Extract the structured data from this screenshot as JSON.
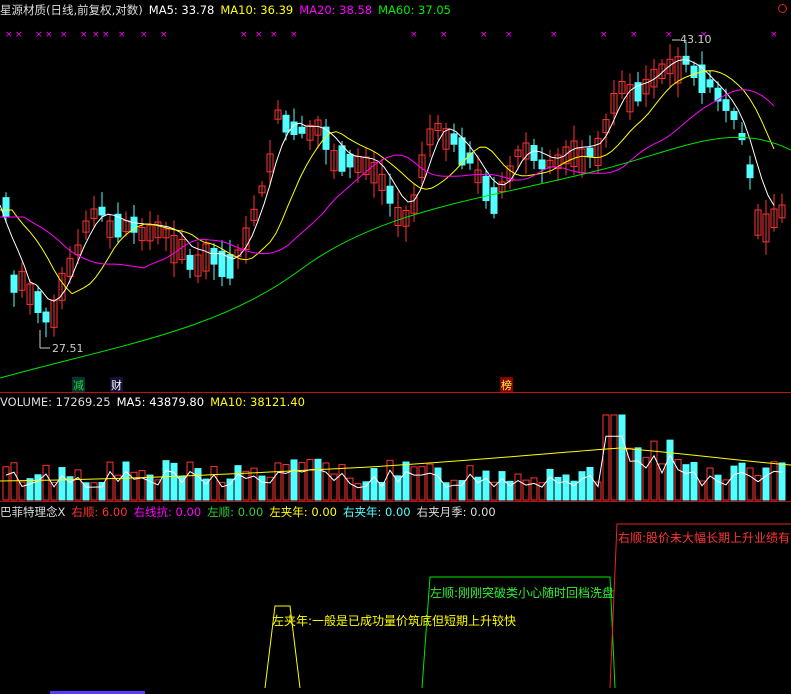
{
  "price_header": {
    "title": "星源材质(日线,前复权,对数)",
    "ma5": "MA5: 33.78",
    "ma10": "MA10: 36.39",
    "ma20": "MA20: 38.58",
    "ma60": "MA60: 37.05"
  },
  "price_labels": {
    "high": "43.10",
    "low": "27.51"
  },
  "event_tags": {
    "jian": "减",
    "cai": "财",
    "bang": "榜"
  },
  "volume_header": {
    "volume": "VOLUME: 17269.25",
    "ma5": "MA5: 43879.80",
    "ma10": "MA10: 38121.40"
  },
  "indicator_header": {
    "name": "巴菲特理念X",
    "youshun": "右顺: 6.00",
    "youxiankang": "右线抗: 0.00",
    "zuoshun": "左顺: 0.00",
    "zuojianian": "左夹年: 0.00",
    "youjianian": "右夹年: 0.00",
    "youjiayueji": "右夹月季: 0.00"
  },
  "indicator_labels": {
    "left_pinch": "左夹年:一般是已成功量价筑底但短期上升较快",
    "left_smooth": "左顺:刚刚突破类小心随时回档洗盘",
    "right_smooth": "右顺:股价未大幅长期上升业绩有"
  },
  "colors": {
    "up": "#ff3232",
    "down": "#54ffff",
    "ma5": "#ffffff",
    "ma10": "#ffff00",
    "ma20": "#ff00ff",
    "ma60": "#00e600",
    "divider": "#b41e1e"
  }
}
